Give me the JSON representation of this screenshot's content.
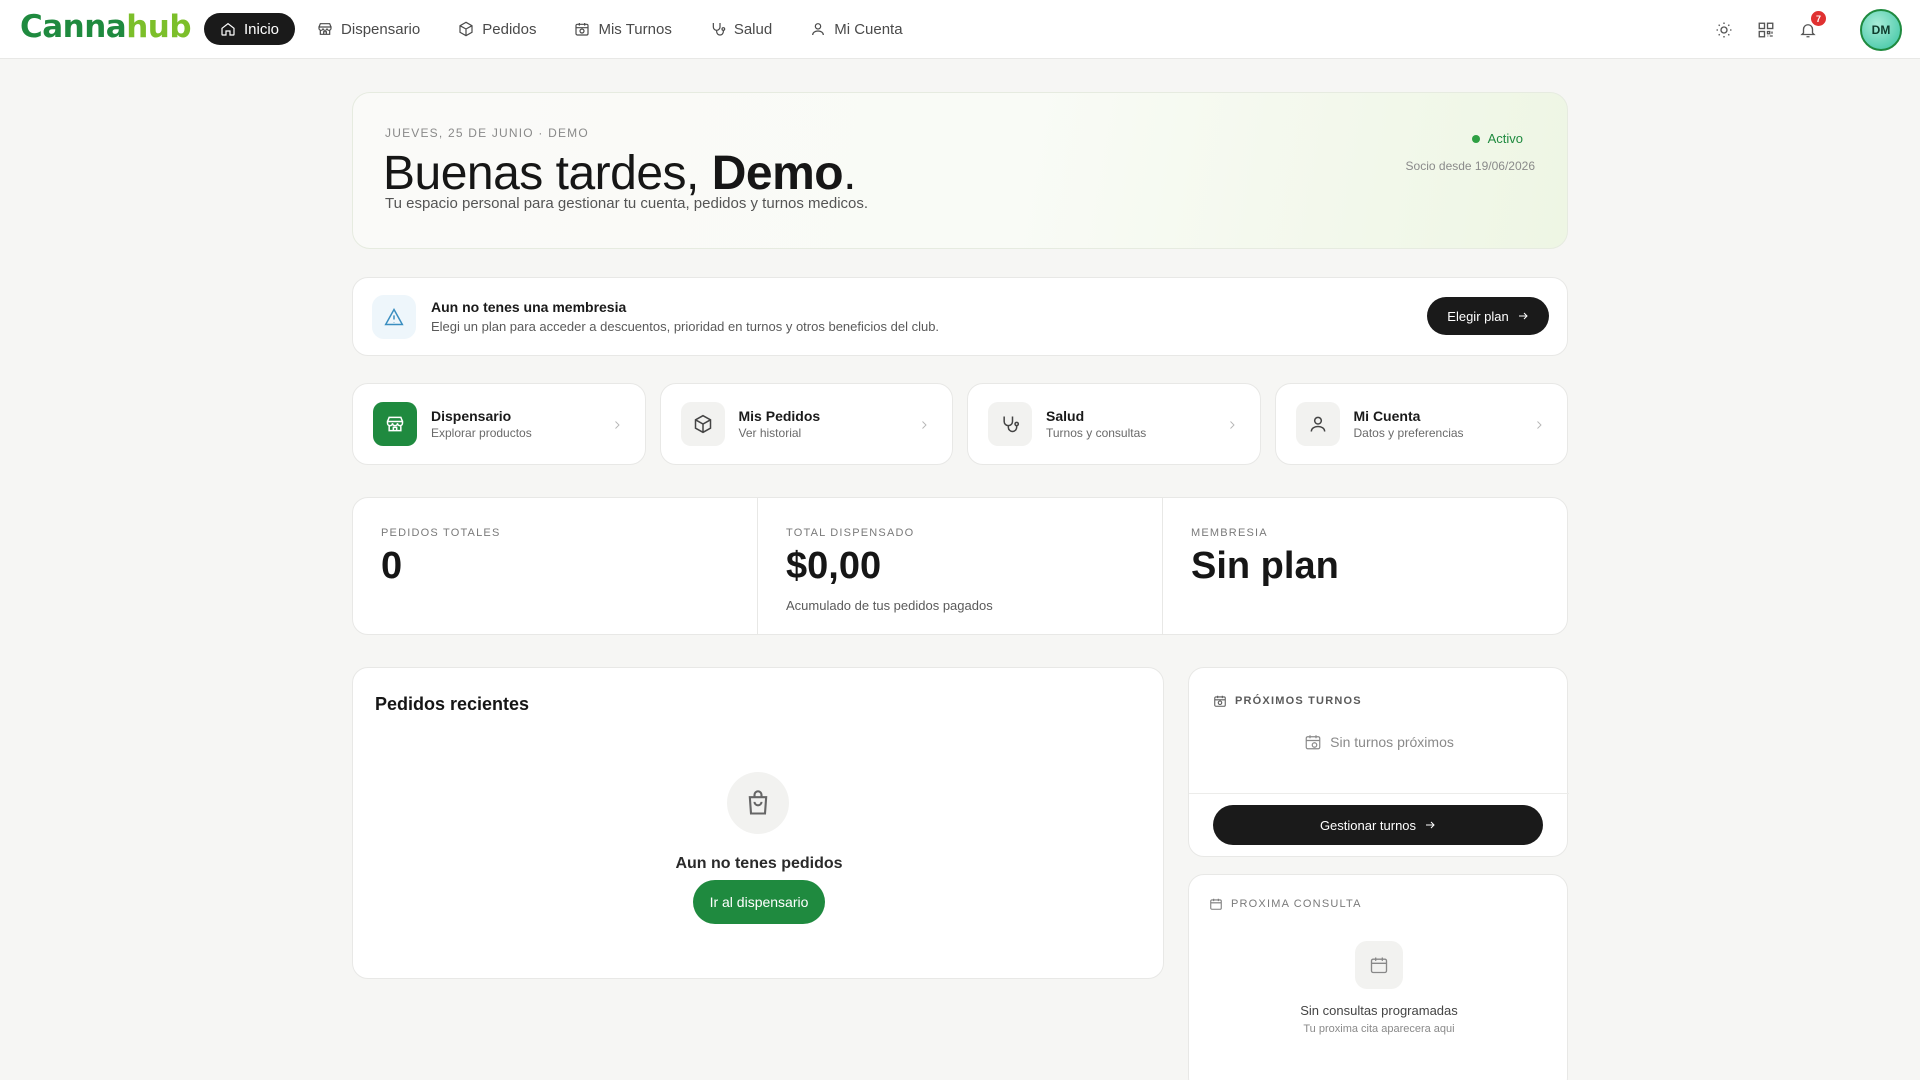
{
  "app": {
    "logo_part1": "Canna",
    "logo_part2": "hub"
  },
  "nav": {
    "items": [
      {
        "label": "Inicio",
        "icon": "home-icon",
        "active": true
      },
      {
        "label": "Dispensario",
        "icon": "store-icon"
      },
      {
        "label": "Pedidos",
        "icon": "package-icon"
      },
      {
        "label": "Mis Turnos",
        "icon": "calendar-clock-icon"
      },
      {
        "label": "Salud",
        "icon": "stethoscope-icon"
      },
      {
        "label": "Mi Cuenta",
        "icon": "user-icon"
      }
    ],
    "notifications_count": "7",
    "avatar_initials": "DM"
  },
  "hero": {
    "date": "JUEVES, 25 DE JUNIO · DEMO",
    "greeting": "Buenas tardes,",
    "name": "Demo",
    "punct": ".",
    "subtitle": "Tu espacio personal para gestionar tu cuenta, pedidos y turnos medicos.",
    "status": "Activo",
    "member_since": "Socio desde 19/06/2026"
  },
  "membership_alert": {
    "title": "Aun no tenes una membresia",
    "text": "Elegi un plan para acceder a descuentos, prioridad en turnos y otros beneficios del club.",
    "button": "Elegir plan"
  },
  "quick_links": [
    {
      "title": "Dispensario",
      "subtitle": "Explorar productos",
      "icon": "store-icon"
    },
    {
      "title": "Mis Pedidos",
      "subtitle": "Ver historial",
      "icon": "package-icon"
    },
    {
      "title": "Salud",
      "subtitle": "Turnos y consultas",
      "icon": "stethoscope-icon"
    },
    {
      "title": "Mi Cuenta",
      "subtitle": "Datos y preferencias",
      "icon": "user-icon"
    }
  ],
  "stats": [
    {
      "label": "PEDIDOS TOTALES",
      "value": "0",
      "note": ""
    },
    {
      "label": "TOTAL DISPENSADO",
      "value": "$0,00",
      "note": "Acumulado de tus pedidos pagados"
    },
    {
      "label": "MEMBRESIA",
      "value": "Sin plan",
      "note": ""
    }
  ],
  "recent_orders": {
    "title": "Pedidos recientes",
    "empty_text": "Aun no tenes pedidos",
    "button": "Ir al dispensario"
  },
  "upcoming_turns": {
    "label": "PRÓXIMOS TURNOS",
    "empty_text": "Sin turnos próximos",
    "button": "Gestionar turnos"
  },
  "next_consult": {
    "label": "PROXIMA CONSULTA",
    "empty_title": "Sin consultas programadas",
    "empty_sub": "Tu proxima cita aparecera aqui"
  },
  "colors": {
    "brand_green": "#1f8a3f",
    "brand_lime": "#7cbf2a",
    "dark": "#1a1a1a",
    "badge_red": "#e03131"
  }
}
